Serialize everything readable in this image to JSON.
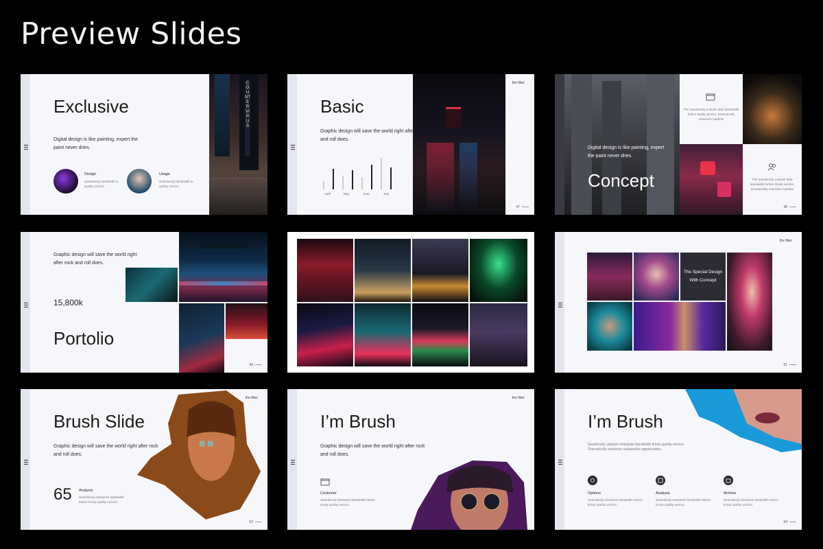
{
  "page": {
    "title": "Preview Slides"
  },
  "slides": {
    "exclusive": {
      "heading": "Exclusive",
      "body": "Digital design is like painting, expert the paint never dries.",
      "items": [
        {
          "label": "Design",
          "desc": "Seamlessly bandwidth to quality vectors."
        },
        {
          "label": "Usage",
          "desc": "Seamlessly bandwidth to quality vectors."
        }
      ],
      "sign": "COUNTERVIRUS"
    },
    "basic": {
      "heading": "Basic",
      "body": "Graphic design will save the world right after rock and roll does.",
      "page": "47",
      "brand": "the fiber"
    },
    "concept": {
      "heading": "Concept",
      "body": "Digital design is like painting, expert the paint never dries.",
      "note1": "The Seamlessly unleash date bandwidth before timely vectors. Dramatically maximize markets",
      "note2": "The Seamlessly unleash date bandwidth before timely vectors. Dramatically maximize markets",
      "page": "48"
    },
    "portfolio": {
      "heading": "Portolio",
      "body": "Graphic design will save the world right after rock and roll does.",
      "stat": "15,800k",
      "page": "49"
    },
    "special": {
      "caption": "The Special Design With Concept",
      "brand": "the fiber",
      "page": "51"
    },
    "brush1": {
      "heading": "Brush Slide",
      "body": "Graphic design will save the world right after rock and roll does.",
      "stat": "65",
      "stat_label": "Analysis",
      "stat_desc": "Seamlessly enterprise bandwidth before timely quality vectors.",
      "brand": "the fiber",
      "page": "52"
    },
    "brush2": {
      "heading": "I’m Brush",
      "body": "Graphic design will save the world right after rock and roll does.",
      "item_label": "Costumer",
      "item_desc": "Seamlessly enterprise bandwidth before timely quality vectors.",
      "brand": "the fiber"
    },
    "brush3": {
      "heading": "I’m Brush",
      "body": "Seamlessly unleash enterprise bandwidth timely quality vectors. Dramatically maximize sustainable opportunities.",
      "items": [
        {
          "label": "Options",
          "desc": "Seamlessly enterprise bandwidth before timely quality vectors."
        },
        {
          "label": "Analysis",
          "desc": "Seamlessly enterprise bandwidth before timely quality vectors."
        },
        {
          "label": "Archive",
          "desc": "Seamlessly enterprise bandwidth before timely quality vectors."
        }
      ],
      "page": "54"
    }
  }
}
